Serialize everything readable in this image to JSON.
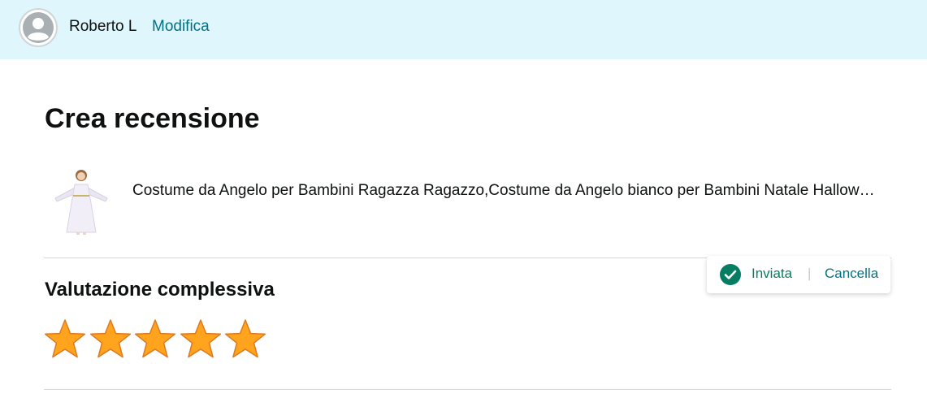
{
  "header": {
    "user_name": "Roberto L",
    "edit_label": "Modifica",
    "avatar_icon": "user-avatar-icon"
  },
  "page": {
    "title": "Crea recensione"
  },
  "product": {
    "title": "Costume da Angelo per Bambini Ragazza Ragazzo,Costume da Angelo bianco per Bambini Natale Halloween Carnevale"
  },
  "rating": {
    "section_title": "Valutazione complessiva",
    "value": 5,
    "max": 5,
    "star_color": "#ffa41c",
    "star_outline": "#de7921"
  },
  "status": {
    "sent_label": "Inviata",
    "separator": "|",
    "cancel_label": "Cancella",
    "check_icon": "check-circle-icon",
    "check_color": "#067d62"
  },
  "colors": {
    "header_bg": "#dff7fc",
    "link": "#007185",
    "divider": "#d5d9d9"
  }
}
